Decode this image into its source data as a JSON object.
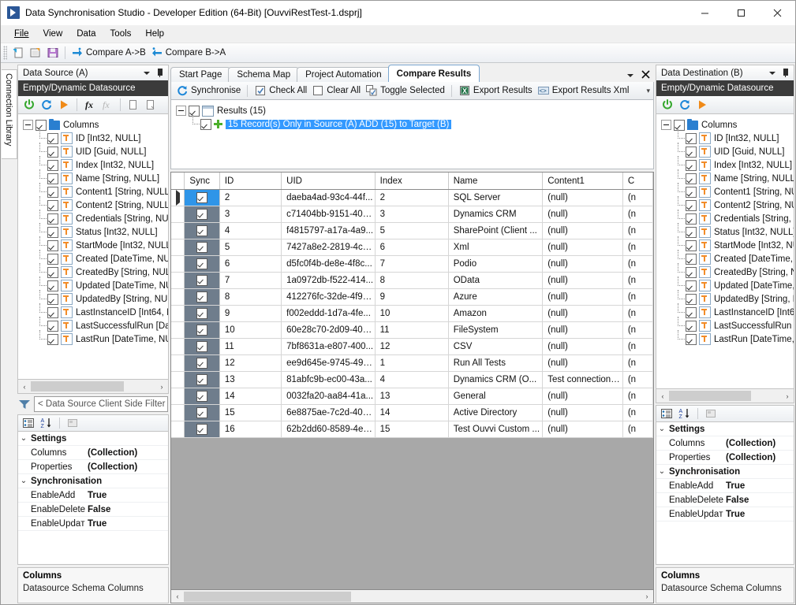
{
  "window": {
    "title": "Data Synchronisation Studio - Developer Edition (64-Bit) [OuvviRestTest-1.dsprj]",
    "minimize": "—",
    "maximize": "□",
    "close": "×"
  },
  "menu": {
    "items": [
      "File",
      "View",
      "Data",
      "Tools",
      "Help"
    ]
  },
  "toolbar": {
    "new_label": "",
    "open_label": "",
    "save_label": "",
    "compare_ab": "Compare A->B",
    "compare_ba": "Compare B->A"
  },
  "connection_library": {
    "label": "Connection Library"
  },
  "source_panel": {
    "header": "Data Source (A)",
    "subbar": "Empty/Dynamic Datasource",
    "root": "Columns",
    "columns": [
      "ID [Int32, NULL]",
      "UID [Guid, NULL]",
      "Index [Int32, NULL]",
      "Name [String, NULL]",
      "Content1 [String, NULL]",
      "Content2 [String, NULL]",
      "Credentials [String, NU",
      "Status [Int32, NULL]",
      "StartMode [Int32, NULL",
      "Created [DateTime, NU",
      "CreatedBy [String, NUL",
      "Updated [DateTime, NU",
      "UpdatedBy [String, NUI",
      "LastInstanceID [Int64, N",
      "LastSuccessfulRun [Dat",
      "LastRun [DateTime, NU"
    ],
    "filter_placeholder": "< Data Source Client Side Filter E",
    "properties": {
      "groups": [
        {
          "name": "Settings",
          "rows": [
            {
              "name": "Columns",
              "value": "(Collection)"
            },
            {
              "name": "Properties",
              "value": "(Collection)"
            }
          ]
        },
        {
          "name": "Synchronisation",
          "rows": [
            {
              "name": "EnableAdd",
              "value": "True"
            },
            {
              "name": "EnableDeletе",
              "value": "False"
            },
            {
              "name": "EnableUpdaт",
              "value": "True"
            }
          ]
        }
      ]
    },
    "description": {
      "title": "Columns",
      "text": "Datasource Schema Columns"
    }
  },
  "destination_panel": {
    "header": "Data Destination (B)",
    "subbar": "Empty/Dynamic Datasource",
    "root": "Columns",
    "columns": [
      "ID [Int32, NULL]",
      "UID [Guid, NULL]",
      "Index [Int32, NULL]",
      "Name [String, NULL]",
      "Content1 [String, NULL",
      "Content2 [String, NULL",
      "Credentials [String, NU",
      "Status [Int32, NULL]",
      "StartMode [Int32, NULL",
      "Created [DateTime, NU",
      "CreatedBy [String, NUL",
      "Updated [DateTime, NL",
      "UpdatedBy [String, NUI",
      "LastInstanceID [Int64, N",
      "LastSuccessfulRun [Dat",
      "LastRun [DateTime, NL"
    ],
    "properties": {
      "groups": [
        {
          "name": "Settings",
          "rows": [
            {
              "name": "Columns",
              "value": "(Collection)"
            },
            {
              "name": "Properties",
              "value": "(Collection)"
            }
          ]
        },
        {
          "name": "Synchronisation",
          "rows": [
            {
              "name": "EnableAdd",
              "value": "True"
            },
            {
              "name": "EnableDeletе",
              "value": "False"
            },
            {
              "name": "EnableUpdaт",
              "value": "True"
            }
          ]
        }
      ]
    },
    "description": {
      "title": "Columns",
      "text": "Datasource Schema Columns"
    }
  },
  "center": {
    "tabs": [
      {
        "label": "Start Page",
        "active": false
      },
      {
        "label": "Schema Map",
        "active": false
      },
      {
        "label": "Project Automation",
        "active": false
      },
      {
        "label": "Compare Results",
        "active": true
      }
    ],
    "toolbar": {
      "synchronise": "Synchronise",
      "check_all": "Check All",
      "clear_all": "Clear All",
      "toggle_selected": "Toggle Selected",
      "export_results": "Export Results",
      "export_results_xml": "Export Results Xml"
    },
    "results_tree": {
      "root": "Results (15)",
      "child": "15 Record(s) Only in Source (A) ADD (15) to Target (B)"
    },
    "grid": {
      "headers": [
        "",
        "Sync",
        "ID",
        "UID",
        "Index",
        "Name",
        "Content1",
        "C"
      ],
      "rows": [
        {
          "marker": true,
          "sync": true,
          "selected": true,
          "id": "2",
          "uid": "daeba4ad-93c4-44f...",
          "index": "2",
          "name": "SQL Server",
          "content1": "(null)",
          "content2": "(n"
        },
        {
          "marker": false,
          "sync": true,
          "selected": false,
          "id": "3",
          "uid": "c71404bb-9151-40d...",
          "index": "3",
          "name": "Dynamics CRM",
          "content1": "(null)",
          "content2": "(n"
        },
        {
          "marker": false,
          "sync": true,
          "selected": false,
          "id": "4",
          "uid": "f4815797-a17a-4a9...",
          "index": "5",
          "name": "SharePoint (Client ...",
          "content1": "(null)",
          "content2": "(n"
        },
        {
          "marker": false,
          "sync": true,
          "selected": false,
          "id": "5",
          "uid": "7427a8e2-2819-4cb...",
          "index": "6",
          "name": "Xml",
          "content1": "(null)",
          "content2": "(n"
        },
        {
          "marker": false,
          "sync": true,
          "selected": false,
          "id": "6",
          "uid": "d5fc0f4b-de8e-4f8c...",
          "index": "7",
          "name": "Podio",
          "content1": "(null)",
          "content2": "(n"
        },
        {
          "marker": false,
          "sync": true,
          "selected": false,
          "id": "7",
          "uid": "1a0972db-f522-414...",
          "index": "8",
          "name": "OData",
          "content1": "(null)",
          "content2": "(n"
        },
        {
          "marker": false,
          "sync": true,
          "selected": false,
          "id": "8",
          "uid": "412276fc-32de-4f99...",
          "index": "9",
          "name": "Azure",
          "content1": "(null)",
          "content2": "(n"
        },
        {
          "marker": false,
          "sync": true,
          "selected": false,
          "id": "9",
          "uid": "f002eddd-1d7a-4fe...",
          "index": "10",
          "name": "Amazon",
          "content1": "(null)",
          "content2": "(n"
        },
        {
          "marker": false,
          "sync": true,
          "selected": false,
          "id": "10",
          "uid": "60e28c70-2d09-40a...",
          "index": "11",
          "name": "FileSystem",
          "content1": "(null)",
          "content2": "(n"
        },
        {
          "marker": false,
          "sync": true,
          "selected": false,
          "id": "11",
          "uid": "7bf8631a-e807-400...",
          "index": "12",
          "name": "CSV",
          "content1": "(null)",
          "content2": "(n"
        },
        {
          "marker": false,
          "sync": true,
          "selected": false,
          "id": "12",
          "uid": "ee9d645e-9745-495...",
          "index": "1",
          "name": "Run All Tests",
          "content1": "(null)",
          "content2": "(n"
        },
        {
          "marker": false,
          "sync": true,
          "selected": false,
          "id": "13",
          "uid": "81abfc9b-ec00-43a...",
          "index": "4",
          "name": "Dynamics CRM (O...",
          "content1": "Test connection to ...",
          "content2": "(n"
        },
        {
          "marker": false,
          "sync": true,
          "selected": false,
          "id": "14",
          "uid": "0032fa20-aa84-41a...",
          "index": "13",
          "name": "General",
          "content1": "(null)",
          "content2": "(n"
        },
        {
          "marker": false,
          "sync": true,
          "selected": false,
          "id": "15",
          "uid": "6e8875ae-7c2d-406...",
          "index": "14",
          "name": "Active Directory",
          "content1": "(null)",
          "content2": "(n"
        },
        {
          "marker": false,
          "sync": true,
          "selected": false,
          "id": "16",
          "uid": "62b2dd60-8589-4e8...",
          "index": "15",
          "name": "Test Ouvvi Custom ...",
          "content1": "(null)",
          "content2": "(n"
        }
      ]
    }
  },
  "colors": {
    "accent_blue": "#3399ff",
    "selected_cell": "#2f95e8",
    "sync_col": "#6f7d8c",
    "subbar_dark": "#3b3b3b",
    "grid_empty": "#a8a8a8",
    "green": "#4caf2a",
    "orange": "#f28c28"
  },
  "scrollbars": {
    "left_arrow": "‹",
    "right_arrow": "›"
  }
}
